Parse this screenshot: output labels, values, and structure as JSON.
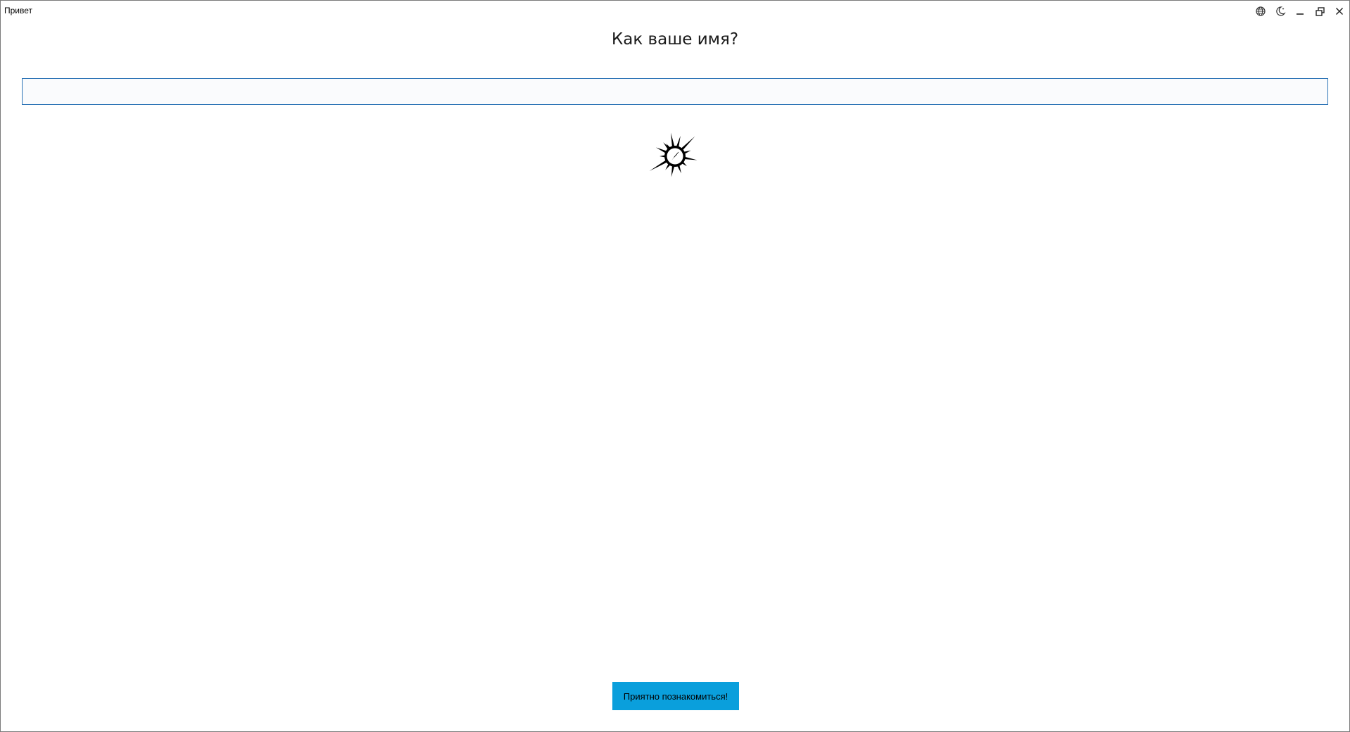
{
  "window": {
    "title": "Привет"
  },
  "titlebar": {
    "icons": [
      "globe-icon",
      "moon-icon",
      "minimize-icon",
      "restore-icon",
      "close-icon"
    ]
  },
  "main": {
    "heading": "Как ваше имя?",
    "name_input": {
      "value": "",
      "placeholder": ""
    },
    "logo_icon": "spiky-sun-compass-logo",
    "submit_label": "Приятно познакомиться!"
  },
  "colors": {
    "accent": "#0a9fdc",
    "input_border": "#2a72b5",
    "input_background": "#fafbfd"
  }
}
